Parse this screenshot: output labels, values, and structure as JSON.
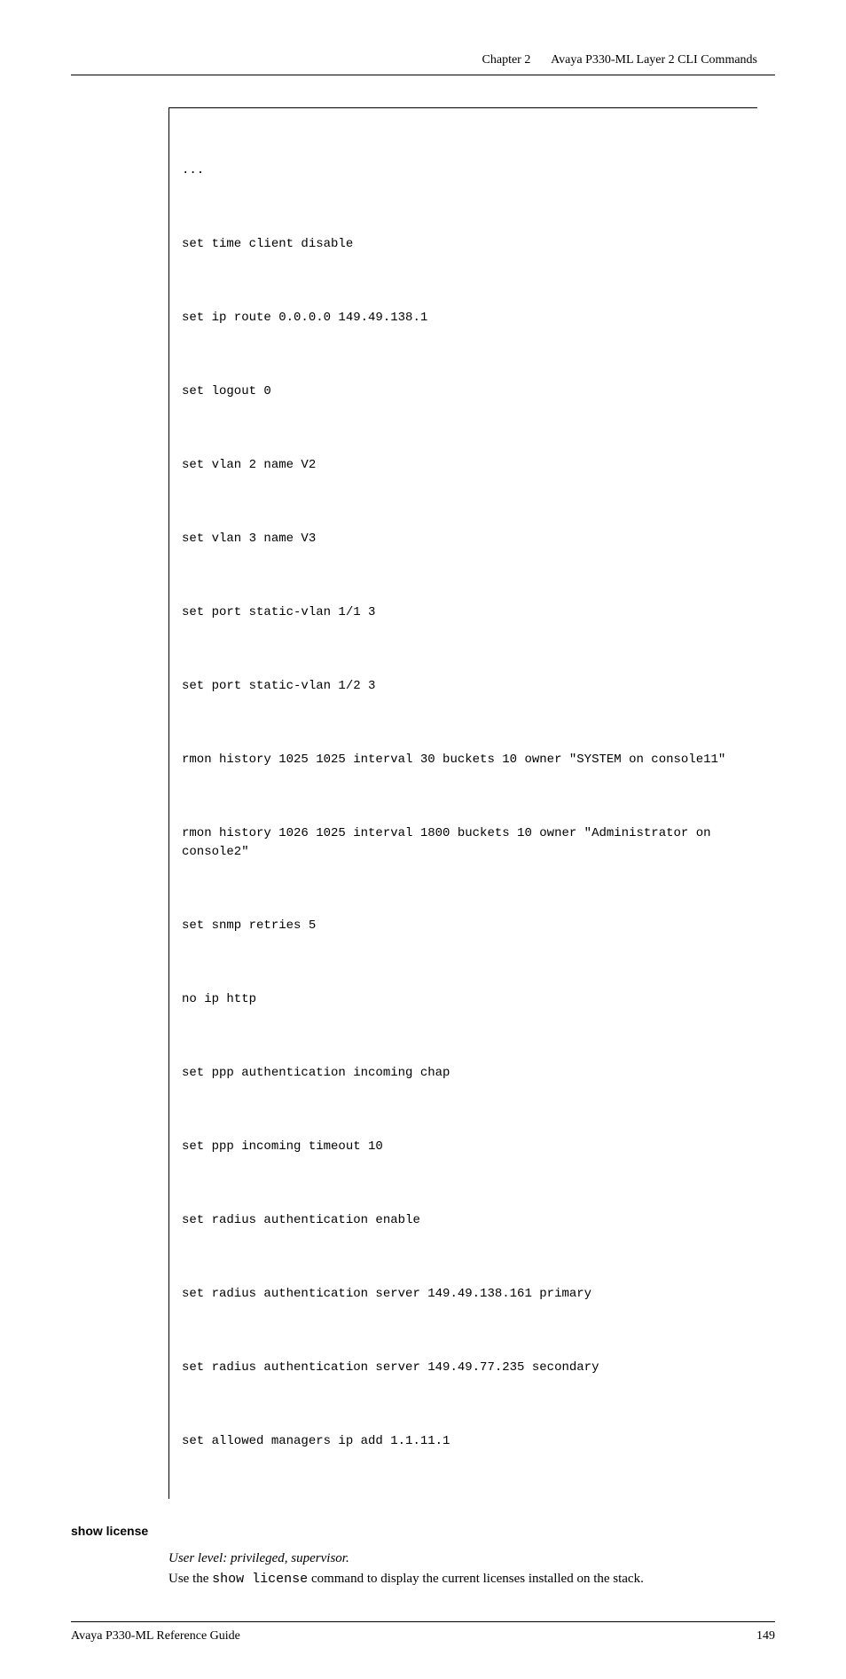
{
  "header": {
    "chapter": "Chapter 2",
    "title": "Avaya P330-ML Layer 2 CLI Commands"
  },
  "code": {
    "l0": "...",
    "l1": "set time client disable",
    "l2": "set ip route 0.0.0.0 149.49.138.1",
    "l3": "set logout 0",
    "l4": "set vlan 2 name V2",
    "l5": "set vlan 3 name V3",
    "l6": "set port static-vlan 1/1 3",
    "l7": "set port static-vlan 1/2 3",
    "l8": "rmon history 1025 1025 interval 30 buckets 10 owner \"SYSTEM on console11\"",
    "l9": "rmon history 1026 1025 interval 1800 buckets 10 owner \"Administrator on console2\"",
    "l10": "set snmp retries 5",
    "l11": "no ip http",
    "l12": "set ppp authentication incoming chap",
    "l13": "set ppp incoming timeout 10",
    "l14": "set radius authentication enable",
    "l15": "set radius authentication server 149.49.138.161 primary",
    "l16": "set radius authentication server 149.49.77.235 secondary",
    "l17": "set allowed managers ip add 1.1.11.1"
  },
  "section": {
    "heading": "show license",
    "user_level": "User level: privileged, supervisor.",
    "desc_pre": "Use the ",
    "desc_cmd": "show license",
    "desc_post": " command to display the current licenses installed on the stack."
  },
  "footer": {
    "left": "Avaya P330-ML Reference Guide",
    "right": "149"
  }
}
